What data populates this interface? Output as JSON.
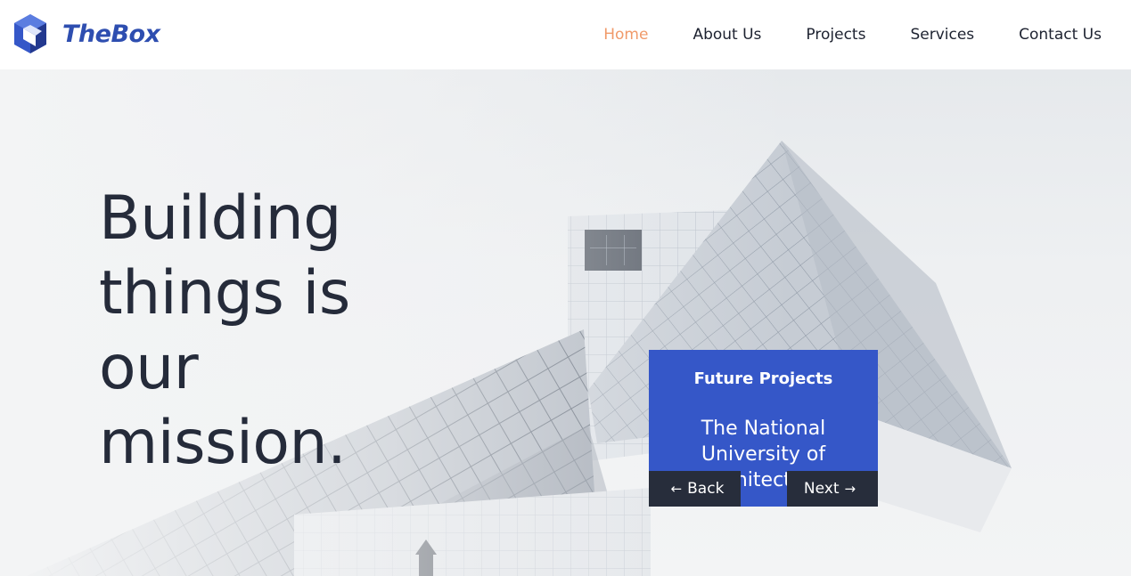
{
  "brand": {
    "name": "TheBox",
    "logo_icon": "cube-icon",
    "color": "#2e4eb0"
  },
  "nav": {
    "items": [
      {
        "label": "Home",
        "active": true
      },
      {
        "label": "About Us",
        "active": false
      },
      {
        "label": "Projects",
        "active": false
      },
      {
        "label": "Services",
        "active": false
      },
      {
        "label": "Contact Us",
        "active": false
      }
    ],
    "active_color": "#f09a6a"
  },
  "hero": {
    "headline": "Building things is our mission.",
    "background_icon": "building-photo"
  },
  "projects_card": {
    "label": "Future Projects",
    "title": "The National University of Architecture",
    "back_label": "Back",
    "next_label": "Next",
    "back_icon": "arrow-left-icon",
    "next_icon": "arrow-right-icon",
    "card_color": "#3557c8",
    "button_color": "#272d3b"
  }
}
